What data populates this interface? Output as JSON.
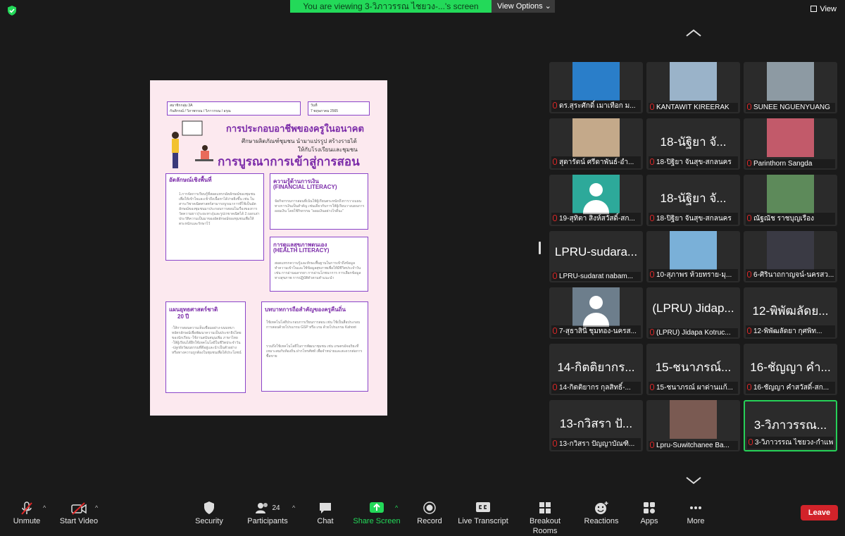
{
  "banner": {
    "text": "You are viewing 3-วิภาวรรณ ไชยวง-...'s screen",
    "view_options": "View Options ⌄",
    "view": "View"
  },
  "poster": {
    "group": "สมาชิกกลุ่ม 3A",
    "members": "กันติกรณ์ / วิภาพรรณ / วิภาวรรณ / อรุณ",
    "date_label": "วันที่",
    "date": "7 พฤษภาคม 2565",
    "title": "การประกอบอาชีพของครูในอนาคต",
    "subtitle1": "ศึกษาผลิตภัณฑ์ชุมชน นำมาแปรรูป สร้างรายได้",
    "subtitle2": "ให้กับโรงเรียนและชุมชน",
    "headline": "การบูรณาการเข้าสู่การสอน",
    "box1_title": "อัตลักษณ์เชิงพื้นที่",
    "box1_text": "1.การจัดการเรียนรู้ที่สอดแทรกอัตลักษณ์ของชุมชนเพื่อให้เข้าใจและเข้าถึงเนื้อหาได้ง่ายยิ่งขึ้น เช่น ในสาระวิชาคณิตศาสตร์สามารถบูรณาการที่ใช้เป็นอัตลักษณ์ของชุมชนมาประกอบการสอนในเรื่องของการวัดความยาว(ระยะทาง)และรูปเรขาคณิตได้ 2.บอกเล่าประวัติความเป็นมาของอัตลักษณ์ของชุมชนเพื่อให้ตระหนักและรักษาไว้",
    "box2_title": "ความรู้ด้านการเงิน",
    "box2_sub": "(FINANCIAL LITERACY)",
    "box2_text": "จัดกิจกรรมการสอนที่เน้นให้ผู้เรียนตระหนักถึงการวางแผนทางการเงินเป็นสำคัญ เช่นเดียวกับการให้ผู้เรียนวางแผนการออมเงิน โดยใช้กิจกรรม \"ออมเงินอย่างไรดีนะ\"",
    "box3_title": "การดูแลสุขภาพตนเอง",
    "box3_sub": "(HEALTH LITERACY)",
    "box3_text": "สอดแทรกความรู้และทักษะพื้นฐานในการเข้าถึงข้อมูล ทำความเข้าใจและใช้ข้อมูลสุขภาพเพื่อให้มีชีวิตประจำวัน เช่น การอ่านฉลากยา การอ่านโภชนาการ การเลือกข้อมูลทางสุขภาพ การปฏิบัติตัวตามคำแนะนำ",
    "box4_title": "แผนยุทธศาสตร์ชาติ",
    "box4_sub": "20 ปี",
    "box4_text": "-ให้การสอนความเจ็บเชื่อมอย่าง-บนบทบาทอัตรลักษณ์เพื่อพัฒนาความเป็นประชาธิปไตยของนักเรียน -ใช้งานสนับสนุนเพิ่ม ภาษาไทย -ให้ผู้เรียนได้ฝึกใช้เทคโนโลยีในชีวิตประจำวัน -ปลูกฝังวัฒนธรรมที่ดีอยู่และนำเป็นตัวอย่างหรือทางความถูกต้องในชุมชนเพื่อได้ประโยชน์",
    "box5_title": "บทบาทการถือสำคัญของครูคืนถิ่น",
    "box5_text1": "ใช้เทคโนโลยีประกอบการเรียนการสอน เช่น ใช้เป็นสื่อประกอบการสอนด้วยโปรแกรม GSP หรือ เกม ด้วยโปรแกรม Kahoot",
    "box5_text2": "รวมถึงใช้เทคโนโลยีในการพัฒนาชุมชน เช่น เกษตรอัจฉริยะที่เหมาะสมกับท้องถิ่น ฝากโทรศัพท์ เพื่อจำหน่ายและสะดวกต่อการซื้อขาย"
  },
  "participants": [
    {
      "label": "ดร.สุระศักดิ์ เมาเทือก ม...",
      "big": "",
      "kind": "photo",
      "color": "#2a7ec9"
    },
    {
      "label": "KANTAWIT KIREERAK",
      "big": "",
      "kind": "photo",
      "color": "#9ab3c9"
    },
    {
      "label": "SUNEE NGUENYUANG",
      "big": "",
      "kind": "photo",
      "color": "#8d9aa3"
    },
    {
      "label": "สุดารัตน์ ศรีดาพันธ์-อำ...",
      "big": "",
      "kind": "photo",
      "color": "#c4a98a"
    },
    {
      "label": "18-ปิฐิยา จันสุข-สกลนคร",
      "big": "18-นัฐิยา จั...",
      "kind": "name",
      "color": ""
    },
    {
      "label": "Parinthorn Sangda",
      "big": "",
      "kind": "photo",
      "color": "#c25a6a"
    },
    {
      "label": "19-สุทิตา สิงห์สวัสดิ์-สก...",
      "big": "",
      "kind": "avatar",
      "color": ""
    },
    {
      "label": "18-ปิฐิยา จันสุข-สกลนคร",
      "big": "18-นัฐิยา จั...",
      "kind": "name",
      "color": ""
    },
    {
      "label": "ณัฐณัช ราชบุญเรือง",
      "big": "",
      "kind": "photo",
      "color": "#5d8a5a"
    },
    {
      "label": "LPRU-sudarat nabam...",
      "big": "LPRU-sudara...",
      "kind": "name",
      "color": ""
    },
    {
      "label": "10-สุภาพร ห้วยทราย-มุ...",
      "big": "",
      "kind": "photo",
      "color": "#7ab0d8"
    },
    {
      "label": "6-ศิรินาถกาญจน์-นครสว...",
      "big": "",
      "kind": "photo",
      "color": "#3a3a44"
    },
    {
      "label": "7-สุธาสินี ชุมทอง-นครส...",
      "big": "",
      "kind": "avatar-gray",
      "color": ""
    },
    {
      "label": "(LPRU) Jidapa Kotruc...",
      "big": "(LPRU) Jidap...",
      "kind": "name",
      "color": ""
    },
    {
      "label": "12-พิพัฒลัดยา กุศพิท...",
      "big": "12-พิพัฒลัดย...",
      "kind": "name",
      "color": ""
    },
    {
      "label": "14-กิตติยากร กุลสิทธิ์-...",
      "big": "14-กิตติยากร...",
      "kind": "name",
      "color": ""
    },
    {
      "label": "15-ชนาภรณ์ ผาด่านแก้...",
      "big": "15-ชนาภรณ์...",
      "kind": "name",
      "color": ""
    },
    {
      "label": "16-ชัญญา คำสวัสดิ์-สก...",
      "big": "16-ชัญญา คำ...",
      "kind": "name",
      "color": ""
    },
    {
      "label": "13-กวิสรา ปัญญาบัณฑิ...",
      "big": "13-กวิสรา ปั...",
      "kind": "name",
      "color": ""
    },
    {
      "label": "Lpru-Suwitchanee Ba...",
      "big": "",
      "kind": "photo",
      "color": "#7a5a52"
    },
    {
      "label": "3-วิภาวรรณ ไชยวง-กำแพ...",
      "big": "3-วิภาวรรณ...",
      "kind": "name",
      "color": "",
      "active": true
    }
  ],
  "toolbar": {
    "unmute": "Unmute",
    "start_video": "Start Video",
    "security": "Security",
    "participants": "Participants",
    "participants_count": "24",
    "chat": "Chat",
    "share_screen": "Share Screen",
    "record": "Record",
    "live_transcript": "Live Transcript",
    "breakout_rooms": "Breakout Rooms",
    "reactions": "Reactions",
    "apps": "Apps",
    "more": "More",
    "leave": "Leave"
  },
  "colors": {
    "accent_green": "#23d959",
    "leave_red": "#d2232a",
    "poster_purple": "#7a2aa8"
  }
}
